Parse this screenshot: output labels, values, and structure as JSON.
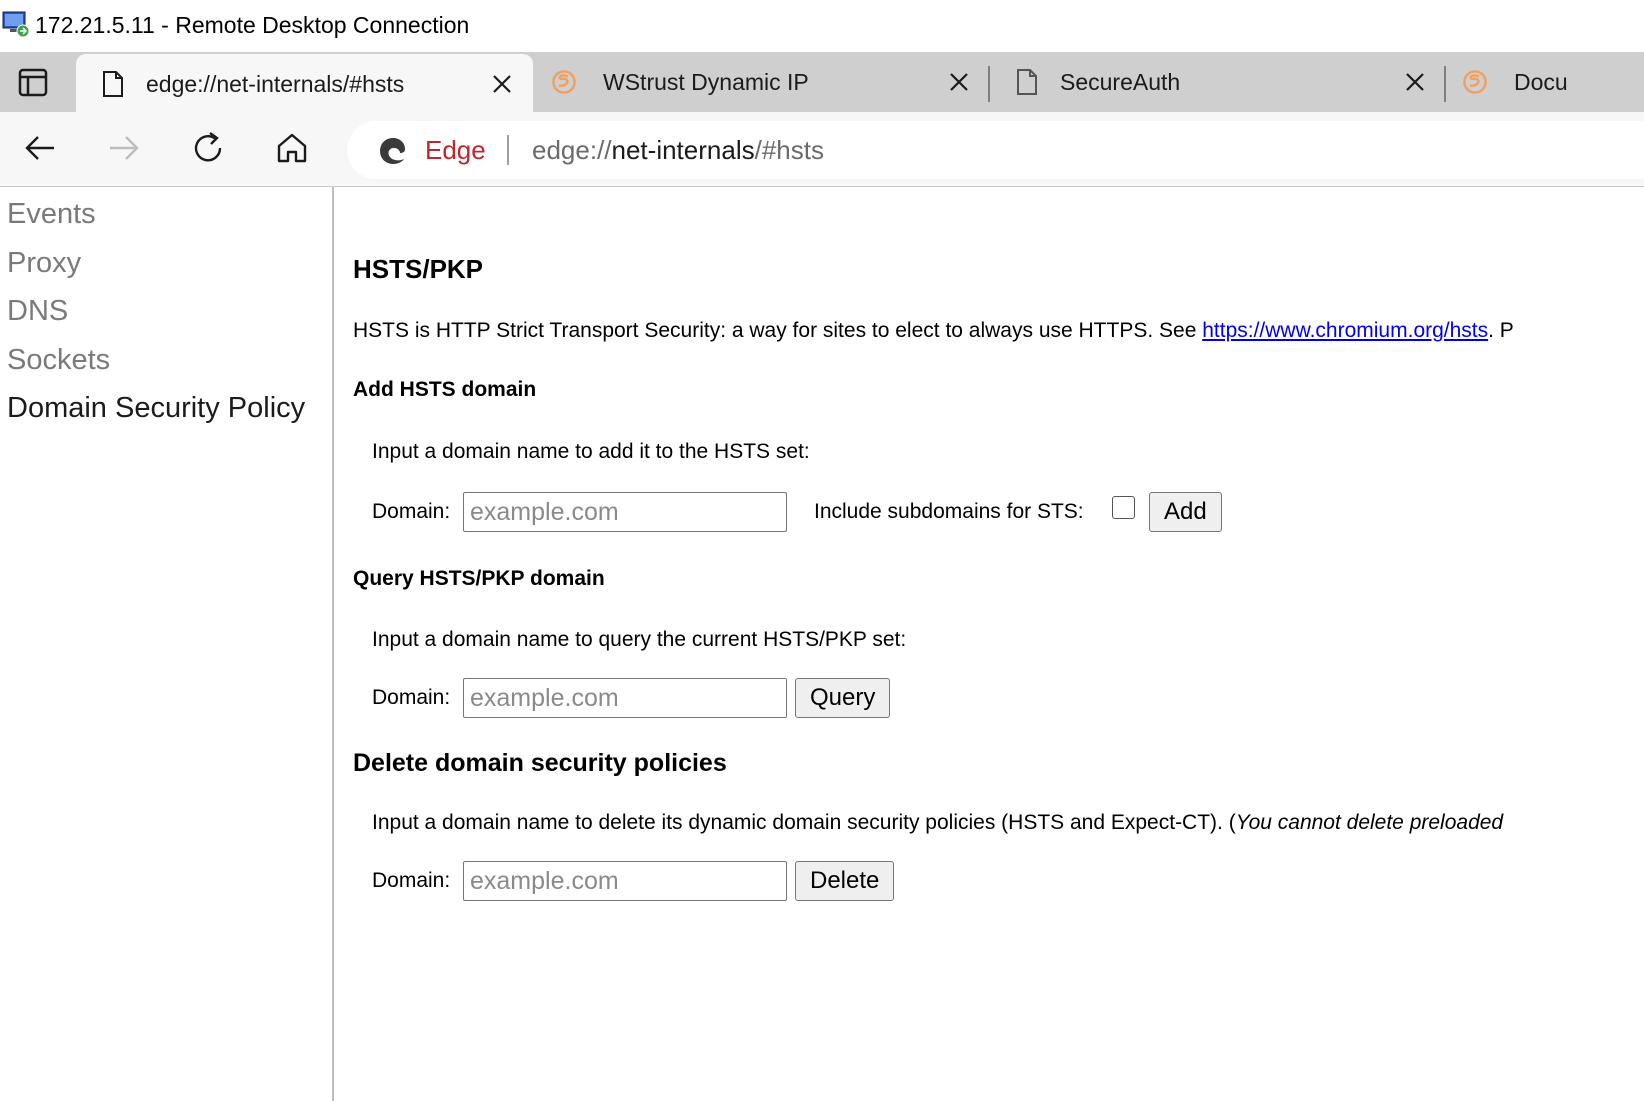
{
  "window": {
    "title": "172.21.5.11 - Remote Desktop Connection",
    "icon": "remote-desktop-icon"
  },
  "tabs": [
    {
      "label": "edge://net-internals/#hsts",
      "icon": "page-icon",
      "active": true
    },
    {
      "label": "WStrust Dynamic IP",
      "icon": "secureauth-logo-icon",
      "active": false
    },
    {
      "label": "SecureAuth",
      "icon": "page-icon",
      "active": false
    },
    {
      "label": "Docu",
      "icon": "secureauth-logo-icon",
      "active": false
    }
  ],
  "address_bar": {
    "browser_label": "Edge",
    "url_scheme": "edge://",
    "url_host": "net-internals",
    "url_path": "/#hsts"
  },
  "sidebar": {
    "items": [
      {
        "label": "Events",
        "selected": false
      },
      {
        "label": "Proxy",
        "selected": false
      },
      {
        "label": "DNS",
        "selected": false
      },
      {
        "label": "Sockets",
        "selected": false
      },
      {
        "label": "Domain Security Policy",
        "selected": true
      }
    ]
  },
  "content": {
    "title": "HSTS/PKP",
    "intro_text": "HSTS is HTTP Strict Transport Security: a way for sites to elect to always use HTTPS. See ",
    "intro_link": "https://www.chromium.org/hsts",
    "intro_after": ". P",
    "add": {
      "heading": "Add HSTS domain",
      "description": "Input a domain name to add it to the HSTS set:",
      "domain_label": "Domain:",
      "placeholder": "example.com",
      "subdomains_label": "Include subdomains for STS:",
      "subdomains_checked": false,
      "button": "Add"
    },
    "query": {
      "heading": "Query HSTS/PKP domain",
      "description": "Input a domain name to query the current HSTS/PKP set:",
      "domain_label": "Domain:",
      "placeholder": "example.com",
      "button": "Query"
    },
    "delete": {
      "heading": "Delete domain security policies",
      "description": "Input a domain name to delete its dynamic domain security policies (HSTS and Expect-CT). (",
      "description_italic": "You cannot delete preloaded",
      "domain_label": "Domain:",
      "placeholder": "example.com",
      "button": "Delete"
    }
  },
  "colors": {
    "edge_label": "#c0262d",
    "link": "#0000ee",
    "tabstrip": "#cfcfcf",
    "secureauth_orange": "#f0a060"
  }
}
